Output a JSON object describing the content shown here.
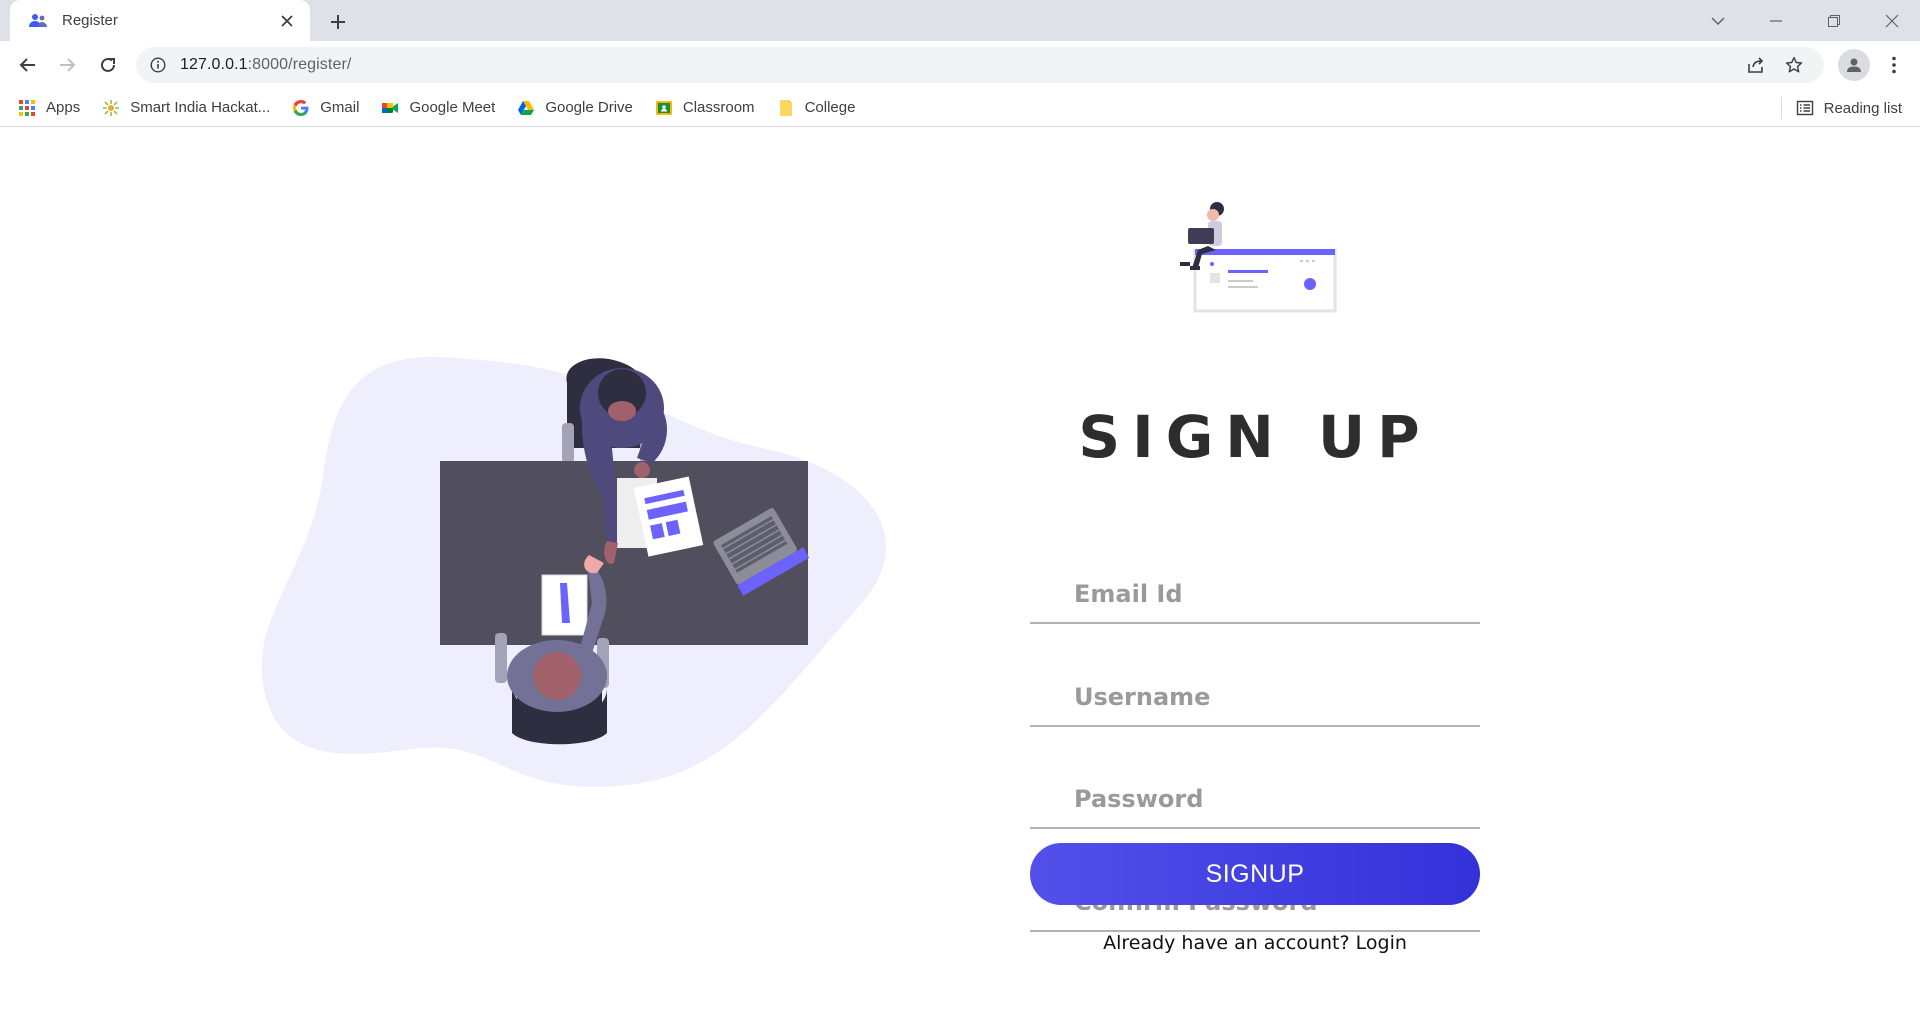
{
  "browser": {
    "tab_title": "Register",
    "url_host": "127.0.0.1",
    "url_path": ":8000/register/",
    "bookmarks": [
      {
        "label": "Apps",
        "icon": "apps-grid-icon"
      },
      {
        "label": "Smart India Hackat...",
        "icon": "sih-icon"
      },
      {
        "label": "Gmail",
        "icon": "google-icon"
      },
      {
        "label": "Google Meet",
        "icon": "meet-icon"
      },
      {
        "label": "Google Drive",
        "icon": "drive-icon"
      },
      {
        "label": "Classroom",
        "icon": "classroom-icon"
      },
      {
        "label": "College",
        "icon": "folder-icon"
      }
    ],
    "reading_list": "Reading list"
  },
  "form": {
    "title": "SIGN UP",
    "email_placeholder": "Email Id",
    "username_placeholder": "Username",
    "password_placeholder": "Password",
    "confirm_placeholder": "Confirm Password",
    "submit_label": "SIGNUP",
    "login_prompt": "Already have an account?",
    "login_link": "Login"
  },
  "colors": {
    "accent": "#4f4ce6",
    "blob": "#efeefd",
    "desk": "#514f5e"
  }
}
